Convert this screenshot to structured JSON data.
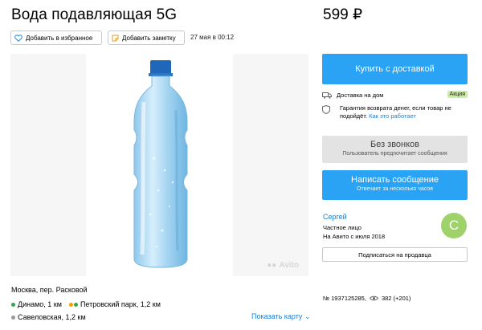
{
  "title": "Вода подавляющая 5G",
  "price": "599 ₽",
  "actions": {
    "favorite_label": "Добавить в избранное",
    "note_label": "Добавить заметку",
    "date": "27 мая в 00:12"
  },
  "photo": {
    "watermark": "Avito"
  },
  "location": {
    "address": "Москва, пер. Расковой",
    "metro": [
      {
        "name": "Динамо, 1 км",
        "color": "#2fa84f"
      },
      {
        "name": "Петровский парк, 1,2 км",
        "color": "#ff9900"
      },
      {
        "name": "Савеловская, 1,2 км",
        "color": "#999999"
      }
    ],
    "show_map": "Показать карту"
  },
  "sidebar": {
    "buy_label": "Купить с доставкой",
    "delivery_label": "Доставка на дом",
    "promo_badge": "Акция",
    "guarantee_text": "Гарантия возврата денег, если товар не подойдёт.",
    "guarantee_link": "Как это работает",
    "no_calls_label": "Без звонков",
    "no_calls_sub": "Пользователь предпочитает сообщения",
    "message_label": "Написать сообщение",
    "message_sub": "Отвечает за несколько часов",
    "seller": {
      "name": "Сергей",
      "type": "Частное лицо",
      "since": "На Авито с июля 2018",
      "avatar_letter": "С"
    },
    "subscribe_label": "Подписаться на продавца",
    "ad_number": "№ 1937125285,",
    "views": "382 (+201)"
  },
  "colors": {
    "accent": "#2aa3f5",
    "link": "#1a7fd6",
    "avatar": "#9fd26a",
    "badge": "#c9ee9e"
  }
}
